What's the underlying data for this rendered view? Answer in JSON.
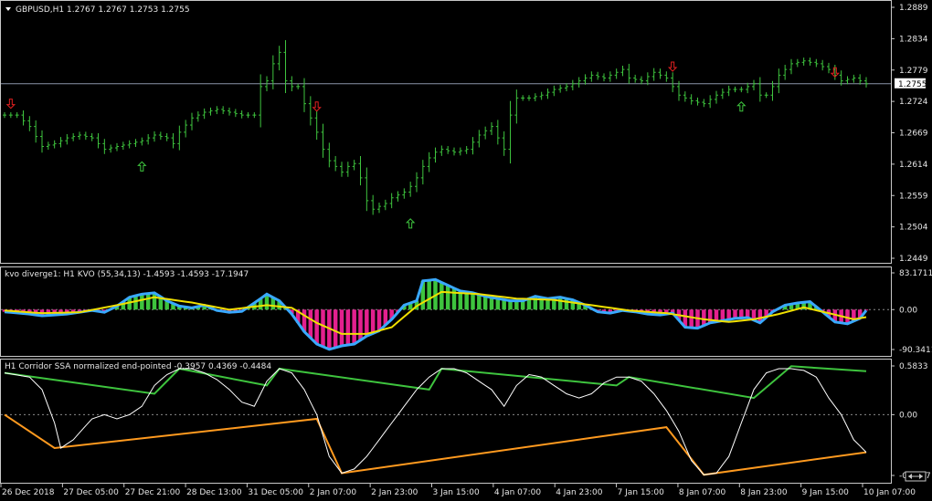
{
  "colors": {
    "background": "#000000",
    "frame": "#c8c8c8",
    "candle": "#3ec43e",
    "kvo_pos": "#3ec43e",
    "kvo_neg": "#e3208e",
    "kvo_line": "#39a9ff",
    "kvo_signal": "#f0e000",
    "ssa_up": "#3ec43e",
    "ssa_down": "#ff9a1f",
    "ssa_mid": "#ffffff",
    "arrow_up": "#3ec43e",
    "arrow_down": "#e02020",
    "price_line": "#8a94a8",
    "label_text": "#e6e6e6"
  },
  "window": {
    "symbol_menu_icon": "triangle-down-icon",
    "main_title": "GBPUSD,H1  1.2767 1.2767 1.2753 1.2755",
    "kvo_title": "kvo diverge1: H1  KVO (55,34,13) -1.4593 -1.4593 -17.1947",
    "ssa_title": "H1 Corridor SSA normalized end-pointed -0.3957 0.4369 -0.4484",
    "current_price_label": "1.2755",
    "main_y_ticks": [
      "1.2889",
      "1.2834",
      "1.2779",
      "1.2724",
      "1.2669",
      "1.2614",
      "1.2559",
      "1.2504",
      "1.2449"
    ],
    "kvo_y_ticks": [
      "83.1711",
      "0.00",
      "-90.3411"
    ],
    "ssa_y_ticks": [
      "0.5833",
      "0.00",
      "-0.7277"
    ],
    "x_ticks": [
      "26 Dec 2018",
      "27 Dec 05:00",
      "27 Dec 21:00",
      "28 Dec 13:00",
      "31 Dec 05:00",
      "2 Jan 07:00",
      "2 Jan 23:00",
      "3 Jan 15:00",
      "4 Jan 07:00",
      "4 Jan 23:00",
      "7 Jan 15:00",
      "8 Jan 07:00",
      "8 Jan 23:00",
      "9 Jan 15:00",
      "10 Jan 07:00"
    ]
  },
  "chart_data": [
    {
      "type": "ohlc",
      "ylim": [
        1.2449,
        1.2889
      ],
      "current_price": 1.2755,
      "close_path": [
        [
          0,
          1.27
        ],
        [
          2,
          1.27
        ],
        [
          4,
          1.268
        ],
        [
          6,
          1.2645
        ],
        [
          8,
          1.265
        ],
        [
          10,
          1.266
        ],
        [
          12,
          1.2665
        ],
        [
          14,
          1.266
        ],
        [
          16,
          1.264
        ],
        [
          18,
          1.2645
        ],
        [
          20,
          1.265
        ],
        [
          22,
          1.2655
        ],
        [
          24,
          1.2665
        ],
        [
          26,
          1.266
        ],
        [
          27,
          1.265
        ],
        [
          28,
          1.267
        ],
        [
          30,
          1.2695
        ],
        [
          32,
          1.2705
        ],
        [
          34,
          1.271
        ],
        [
          36,
          1.2705
        ],
        [
          38,
          1.27
        ],
        [
          40,
          1.27
        ],
        [
          41,
          1.275
        ],
        [
          42,
          1.276
        ],
        [
          43,
          1.279
        ],
        [
          44,
          1.281
        ],
        [
          45,
          1.276
        ],
        [
          46,
          1.275
        ],
        [
          47,
          1.275
        ],
        [
          48,
          1.272
        ],
        [
          49,
          1.2695
        ],
        [
          50,
          1.267
        ],
        [
          51,
          1.264
        ],
        [
          52,
          1.262
        ],
        [
          53,
          1.261
        ],
        [
          54,
          1.26
        ],
        [
          55,
          1.261
        ],
        [
          56,
          1.2615
        ],
        [
          57,
          1.259
        ],
        [
          58,
          1.255
        ],
        [
          59,
          1.2535
        ],
        [
          60,
          1.254
        ],
        [
          61,
          1.2545
        ],
        [
          62,
          1.2555
        ],
        [
          63,
          1.256
        ],
        [
          64,
          1.2565
        ],
        [
          65,
          1.2575
        ],
        [
          66,
          1.259
        ],
        [
          67,
          1.261
        ],
        [
          68,
          1.2625
        ],
        [
          69,
          1.2635
        ],
        [
          70,
          1.264
        ],
        [
          72,
          1.2635
        ],
        [
          74,
          1.264
        ],
        [
          76,
          1.2665
        ],
        [
          78,
          1.268
        ],
        [
          80,
          1.264
        ],
        [
          81,
          1.27
        ],
        [
          82,
          1.273
        ],
        [
          84,
          1.273
        ],
        [
          86,
          1.2735
        ],
        [
          88,
          1.2745
        ],
        [
          90,
          1.275
        ],
        [
          92,
          1.276
        ],
        [
          94,
          1.277
        ],
        [
          96,
          1.2765
        ],
        [
          98,
          1.2775
        ],
        [
          99,
          1.278
        ],
        [
          100,
          1.2765
        ],
        [
          102,
          1.276
        ],
        [
          104,
          1.2775
        ],
        [
          106,
          1.2765
        ],
        [
          108,
          1.2735
        ],
        [
          110,
          1.2725
        ],
        [
          112,
          1.272
        ],
        [
          114,
          1.2735
        ],
        [
          116,
          1.2745
        ],
        [
          118,
          1.2745
        ],
        [
          120,
          1.2755
        ],
        [
          121,
          1.2735
        ],
        [
          122,
          1.2735
        ],
        [
          123,
          1.275
        ],
        [
          124,
          1.277
        ],
        [
          125,
          1.278
        ],
        [
          126,
          1.279
        ],
        [
          128,
          1.2795
        ],
        [
          130,
          1.279
        ],
        [
          132,
          1.278
        ],
        [
          134,
          1.276
        ],
        [
          136,
          1.2765
        ],
        [
          138,
          1.2755
        ]
      ],
      "total_bars": 139,
      "up_arrows": [
        [
          22,
          1.261
        ],
        [
          65,
          1.251
        ],
        [
          118,
          1.2715
        ]
      ],
      "down_arrows": [
        [
          1,
          1.272
        ],
        [
          50,
          1.2715
        ],
        [
          107,
          1.2785
        ],
        [
          133,
          1.2775
        ]
      ]
    },
    {
      "type": "histogram+lines",
      "name": "kvo diverge1",
      "ylim": [
        -90.3411,
        83.1711
      ],
      "histogram": [
        [
          0,
          -5
        ],
        [
          4,
          -10
        ],
        [
          6,
          -14
        ],
        [
          10,
          -10
        ],
        [
          14,
          -2
        ],
        [
          16,
          -6
        ],
        [
          18,
          8
        ],
        [
          20,
          28
        ],
        [
          22,
          35
        ],
        [
          24,
          38
        ],
        [
          26,
          20
        ],
        [
          28,
          8
        ],
        [
          30,
          4
        ],
        [
          32,
          10
        ],
        [
          34,
          -2
        ],
        [
          36,
          -6
        ],
        [
          38,
          -4
        ],
        [
          40,
          15
        ],
        [
          42,
          35
        ],
        [
          44,
          20
        ],
        [
          46,
          -10
        ],
        [
          48,
          -50
        ],
        [
          50,
          -78
        ],
        [
          52,
          -90
        ],
        [
          54,
          -82
        ],
        [
          56,
          -78
        ],
        [
          58,
          -60
        ],
        [
          60,
          -48
        ],
        [
          62,
          -22
        ],
        [
          64,
          10
        ],
        [
          66,
          20
        ],
        [
          67,
          65
        ],
        [
          69,
          68
        ],
        [
          71,
          55
        ],
        [
          73,
          42
        ],
        [
          75,
          38
        ],
        [
          77,
          30
        ],
        [
          79,
          25
        ],
        [
          81,
          20
        ],
        [
          83,
          20
        ],
        [
          85,
          30
        ],
        [
          87,
          25
        ],
        [
          89,
          28
        ],
        [
          91,
          22
        ],
        [
          93,
          10
        ],
        [
          95,
          -5
        ],
        [
          97,
          -8
        ],
        [
          99,
          -2
        ],
        [
          101,
          -5
        ],
        [
          103,
          -10
        ],
        [
          105,
          -12
        ],
        [
          107,
          -8
        ],
        [
          109,
          -40
        ],
        [
          111,
          -42
        ],
        [
          113,
          -30
        ],
        [
          115,
          -25
        ],
        [
          117,
          -20
        ],
        [
          119,
          -18
        ],
        [
          121,
          -30
        ],
        [
          123,
          -5
        ],
        [
          125,
          10
        ],
        [
          127,
          15
        ],
        [
          129,
          18
        ],
        [
          131,
          -5
        ],
        [
          133,
          -28
        ],
        [
          135,
          -32
        ],
        [
          137,
          -20
        ],
        [
          138,
          -2
        ]
      ],
      "signal": [
        [
          0,
          -2
        ],
        [
          6,
          -8
        ],
        [
          12,
          -6
        ],
        [
          18,
          10
        ],
        [
          24,
          28
        ],
        [
          30,
          16
        ],
        [
          36,
          0
        ],
        [
          42,
          10
        ],
        [
          46,
          4
        ],
        [
          50,
          -30
        ],
        [
          54,
          -55
        ],
        [
          58,
          -55
        ],
        [
          62,
          -40
        ],
        [
          66,
          8
        ],
        [
          70,
          40
        ],
        [
          76,
          35
        ],
        [
          82,
          25
        ],
        [
          88,
          22
        ],
        [
          94,
          10
        ],
        [
          100,
          -2
        ],
        [
          106,
          -8
        ],
        [
          112,
          -22
        ],
        [
          116,
          -28
        ],
        [
          120,
          -22
        ],
        [
          124,
          -10
        ],
        [
          128,
          5
        ],
        [
          132,
          -8
        ],
        [
          136,
          -22
        ],
        [
          138,
          -17
        ]
      ]
    },
    {
      "type": "line",
      "name": "Corridor SSA",
      "ylim": [
        -0.7277,
        0.5833
      ],
      "ssa_mid": [
        [
          0,
          0.5
        ],
        [
          4,
          0.45
        ],
        [
          6,
          0.3
        ],
        [
          8,
          -0.1
        ],
        [
          9,
          -0.4
        ],
        [
          11,
          -0.3
        ],
        [
          14,
          -0.05
        ],
        [
          16,
          0.0
        ],
        [
          18,
          -0.05
        ],
        [
          20,
          0.0
        ],
        [
          22,
          0.1
        ],
        [
          24,
          0.35
        ],
        [
          26,
          0.48
        ],
        [
          28,
          0.55
        ],
        [
          30,
          0.55
        ],
        [
          32,
          0.5
        ],
        [
          34,
          0.42
        ],
        [
          36,
          0.3
        ],
        [
          38,
          0.15
        ],
        [
          40,
          0.1
        ],
        [
          42,
          0.4
        ],
        [
          44,
          0.55
        ],
        [
          46,
          0.5
        ],
        [
          48,
          0.3
        ],
        [
          50,
          0.0
        ],
        [
          52,
          -0.5
        ],
        [
          54,
          -0.7
        ],
        [
          56,
          -0.65
        ],
        [
          58,
          -0.5
        ],
        [
          60,
          -0.3
        ],
        [
          62,
          -0.1
        ],
        [
          64,
          0.1
        ],
        [
          66,
          0.3
        ],
        [
          68,
          0.45
        ],
        [
          70,
          0.55
        ],
        [
          72,
          0.55
        ],
        [
          74,
          0.5
        ],
        [
          76,
          0.4
        ],
        [
          78,
          0.3
        ],
        [
          80,
          0.1
        ],
        [
          82,
          0.35
        ],
        [
          84,
          0.48
        ],
        [
          86,
          0.45
        ],
        [
          88,
          0.35
        ],
        [
          90,
          0.25
        ],
        [
          92,
          0.2
        ],
        [
          94,
          0.25
        ],
        [
          96,
          0.38
        ],
        [
          98,
          0.45
        ],
        [
          100,
          0.45
        ],
        [
          102,
          0.4
        ],
        [
          104,
          0.25
        ],
        [
          106,
          0.05
        ],
        [
          108,
          -0.2
        ],
        [
          110,
          -0.55
        ],
        [
          112,
          -0.72
        ],
        [
          114,
          -0.7
        ],
        [
          116,
          -0.5
        ],
        [
          118,
          -0.1
        ],
        [
          120,
          0.3
        ],
        [
          122,
          0.5
        ],
        [
          124,
          0.55
        ],
        [
          126,
          0.55
        ],
        [
          128,
          0.53
        ],
        [
          130,
          0.45
        ],
        [
          132,
          0.2
        ],
        [
          134,
          0.0
        ],
        [
          136,
          -0.3
        ],
        [
          138,
          -0.45
        ]
      ],
      "ssa_up_segments": [
        [
          [
            0,
            0.5
          ],
          [
            24,
            0.25
          ],
          [
            28,
            0.55
          ],
          [
            42,
            0.35
          ],
          [
            44,
            0.55
          ],
          [
            68,
            0.3
          ],
          [
            70,
            0.55
          ],
          [
            98,
            0.35
          ],
          [
            100,
            0.45
          ],
          [
            120,
            0.2
          ],
          [
            126,
            0.58
          ],
          [
            138,
            0.52
          ]
        ]
      ],
      "ssa_down_segments": [
        [
          [
            0,
            0.0
          ],
          [
            8,
            -0.4
          ],
          [
            50,
            -0.05
          ],
          [
            54,
            -0.7
          ],
          [
            106,
            -0.15
          ],
          [
            112,
            -0.72
          ],
          [
            138,
            -0.45
          ]
        ]
      ]
    }
  ]
}
